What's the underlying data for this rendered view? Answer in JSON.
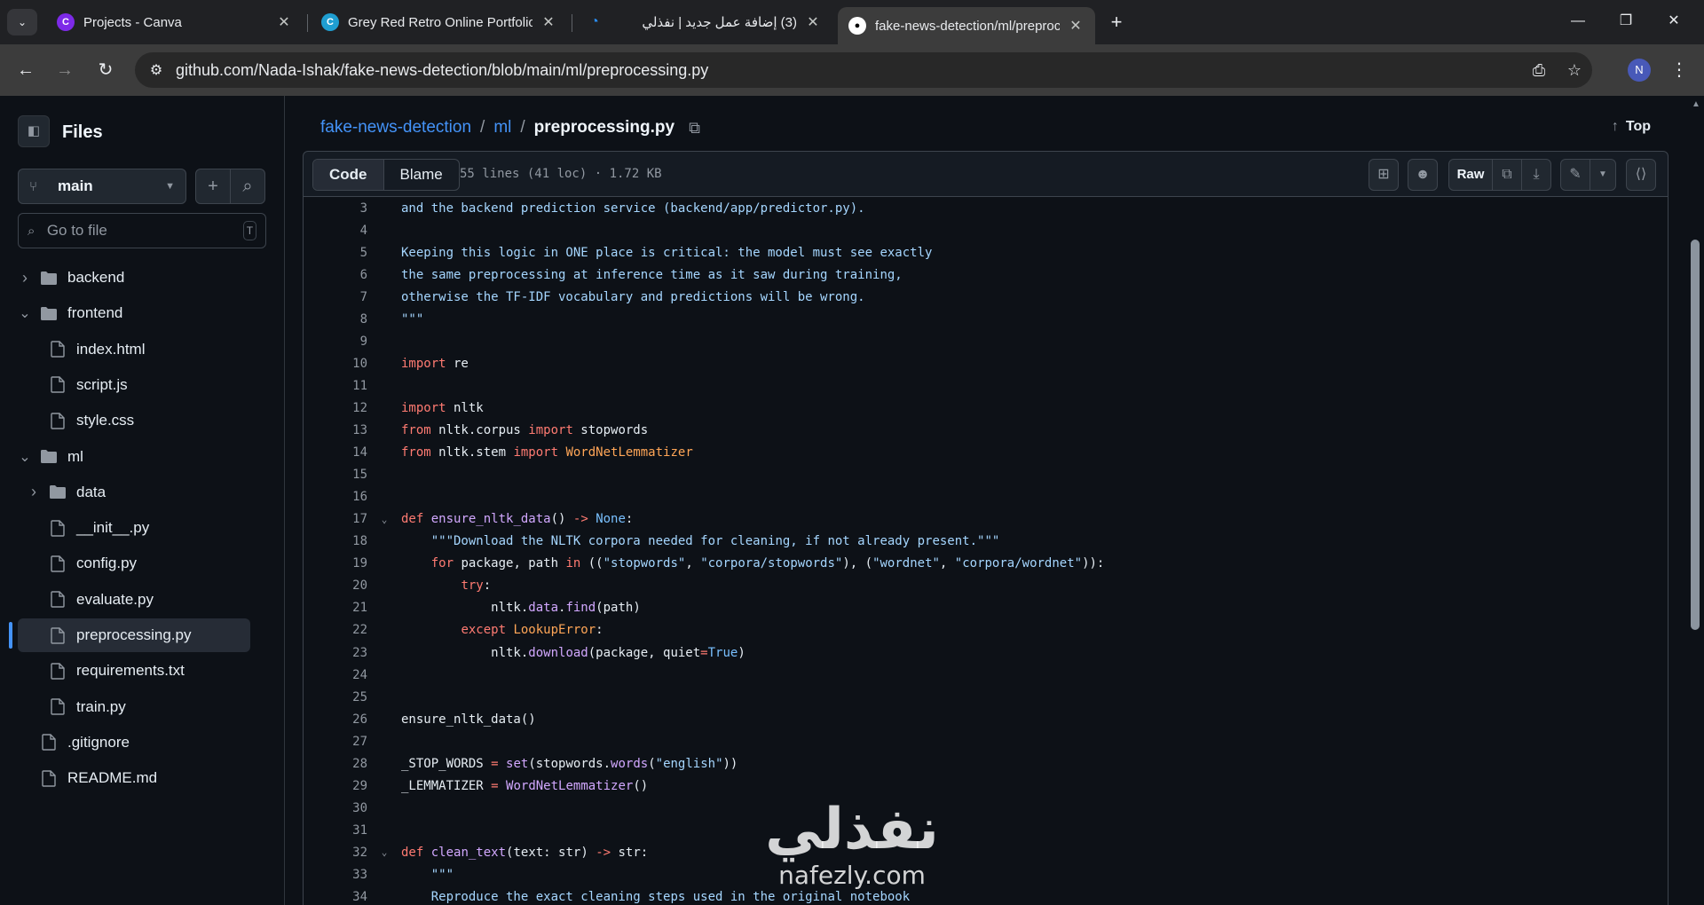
{
  "browser": {
    "tabs": [
      {
        "title": "Projects - Canva",
        "favicon": "canva-icon",
        "active": false
      },
      {
        "title": "Grey Red Retro Online Portfolio",
        "favicon": "canva-icon",
        "active": false
      },
      {
        "title": "(3) إضافة عمل جديد | نفذلي",
        "favicon": "nafezly-icon",
        "active": false
      },
      {
        "title": "fake-news-detection/ml/preproc",
        "favicon": "github-icon",
        "active": true
      }
    ],
    "url": "github.com/Nada-Ishak/fake-news-detection/blob/main/ml/preprocessing.py",
    "profile_initial": "N"
  },
  "sidebar": {
    "title": "Files",
    "branch": "main",
    "search_placeholder": "Go to file",
    "search_shortcut": "T",
    "tree": [
      {
        "label": "backend",
        "type": "folder",
        "depth": 0,
        "expanded": false
      },
      {
        "label": "frontend",
        "type": "folder",
        "depth": 0,
        "expanded": true
      },
      {
        "label": "index.html",
        "type": "file",
        "depth": 1
      },
      {
        "label": "script.js",
        "type": "file",
        "depth": 1
      },
      {
        "label": "style.css",
        "type": "file",
        "depth": 1
      },
      {
        "label": "ml",
        "type": "folder",
        "depth": 0,
        "expanded": true
      },
      {
        "label": "data",
        "type": "folder",
        "depth": 1,
        "expanded": false
      },
      {
        "label": "__init__.py",
        "type": "file",
        "depth": 1
      },
      {
        "label": "config.py",
        "type": "file",
        "depth": 1
      },
      {
        "label": "evaluate.py",
        "type": "file",
        "depth": 1
      },
      {
        "label": "preprocessing.py",
        "type": "file",
        "depth": 1,
        "selected": true
      },
      {
        "label": "requirements.txt",
        "type": "file",
        "depth": 1
      },
      {
        "label": "train.py",
        "type": "file",
        "depth": 1
      },
      {
        "label": ".gitignore",
        "type": "file",
        "depth": 0
      },
      {
        "label": "README.md",
        "type": "file",
        "depth": 0
      }
    ]
  },
  "breadcrumb": {
    "repo": "fake-news-detection",
    "dir": "ml",
    "file": "preprocessing.py",
    "sep": "/"
  },
  "top_label": "Top",
  "file_header": {
    "tab_code": "Code",
    "tab_blame": "Blame",
    "meta": "55 lines (41 loc) · 1.72 KB",
    "raw_label": "Raw"
  },
  "code_lines": [
    {
      "n": "3",
      "fold": false,
      "tokens": [
        [
          "s",
          "and the backend prediction service (backend/app/predictor.py).\n"
        ]
      ]
    },
    {
      "n": "4",
      "fold": false,
      "tokens": []
    },
    {
      "n": "5",
      "fold": false,
      "tokens": [
        [
          "s",
          "Keeping this logic in ONE place is critical: the model must see exactly"
        ]
      ]
    },
    {
      "n": "6",
      "fold": false,
      "tokens": [
        [
          "s",
          "the same preprocessing at inference time as it saw during training,"
        ]
      ]
    },
    {
      "n": "7",
      "fold": false,
      "tokens": [
        [
          "s",
          "otherwise the TF-IDF vocabulary and predictions will be wrong."
        ]
      ]
    },
    {
      "n": "8",
      "fold": false,
      "tokens": [
        [
          "s",
          "\"\"\""
        ]
      ]
    },
    {
      "n": "9",
      "fold": false,
      "tokens": []
    },
    {
      "n": "10",
      "fold": false,
      "tokens": [
        [
          "k",
          "import"
        ],
        [
          "src",
          " re"
        ]
      ]
    },
    {
      "n": "11",
      "fold": false,
      "tokens": []
    },
    {
      "n": "12",
      "fold": false,
      "tokens": [
        [
          "k",
          "import"
        ],
        [
          "src",
          " nltk"
        ]
      ]
    },
    {
      "n": "13",
      "fold": false,
      "tokens": [
        [
          "k",
          "from"
        ],
        [
          "src",
          " nltk.corpus "
        ],
        [
          "k",
          "import"
        ],
        [
          "src",
          " stopwords"
        ]
      ]
    },
    {
      "n": "14",
      "fold": false,
      "tokens": [
        [
          "k",
          "from"
        ],
        [
          "src",
          " nltk.stem "
        ],
        [
          "k",
          "import"
        ],
        [
          "src",
          " "
        ],
        [
          "cl",
          "WordNetLemmatizer"
        ]
      ]
    },
    {
      "n": "15",
      "fold": false,
      "tokens": []
    },
    {
      "n": "16",
      "fold": false,
      "tokens": []
    },
    {
      "n": "17",
      "fold": true,
      "tokens": [
        [
          "k",
          "def"
        ],
        [
          "src",
          " "
        ],
        [
          "f",
          "ensure_nltk_data"
        ],
        [
          "src",
          "() "
        ],
        [
          "k",
          "->"
        ],
        [
          "src",
          " "
        ],
        [
          "c",
          "None"
        ],
        [
          "src",
          ":"
        ]
      ]
    },
    {
      "n": "18",
      "fold": false,
      "tokens": [
        [
          "src",
          "    "
        ],
        [
          "s",
          "\"\"\"Download the NLTK corpora needed for cleaning, if not already present.\"\"\""
        ]
      ]
    },
    {
      "n": "19",
      "fold": false,
      "tokens": [
        [
          "src",
          "    "
        ],
        [
          "k",
          "for"
        ],
        [
          "src",
          " package, path "
        ],
        [
          "k",
          "in"
        ],
        [
          "src",
          " (("
        ],
        [
          "s",
          "\"stopwords\""
        ],
        [
          "src",
          ", "
        ],
        [
          "s",
          "\"corpora/stopwords\""
        ],
        [
          "src",
          "), ("
        ],
        [
          "s",
          "\"wordnet\""
        ],
        [
          "src",
          ", "
        ],
        [
          "s",
          "\"corpora/wordnet\""
        ],
        [
          "src",
          ")):"
        ]
      ]
    },
    {
      "n": "20",
      "fold": false,
      "tokens": [
        [
          "src",
          "        "
        ],
        [
          "k",
          "try"
        ],
        [
          "src",
          ":"
        ]
      ]
    },
    {
      "n": "21",
      "fold": false,
      "tokens": [
        [
          "src",
          "            nltk."
        ],
        [
          "f",
          "data"
        ],
        [
          "src",
          "."
        ],
        [
          "f",
          "find"
        ],
        [
          "src",
          "(path)"
        ]
      ]
    },
    {
      "n": "22",
      "fold": false,
      "tokens": [
        [
          "src",
          "        "
        ],
        [
          "k",
          "except"
        ],
        [
          "src",
          " "
        ],
        [
          "cl",
          "LookupError"
        ],
        [
          "src",
          ":"
        ]
      ]
    },
    {
      "n": "23",
      "fold": false,
      "tokens": [
        [
          "src",
          "            nltk."
        ],
        [
          "f",
          "download"
        ],
        [
          "src",
          "(package, quiet"
        ],
        [
          "k",
          "="
        ],
        [
          "c",
          "True"
        ],
        [
          "src",
          ")"
        ]
      ]
    },
    {
      "n": "24",
      "fold": false,
      "tokens": []
    },
    {
      "n": "25",
      "fold": false,
      "tokens": []
    },
    {
      "n": "26",
      "fold": false,
      "tokens": [
        [
          "src",
          "ensure_nltk_data()"
        ]
      ]
    },
    {
      "n": "27",
      "fold": false,
      "tokens": []
    },
    {
      "n": "28",
      "fold": false,
      "tokens": [
        [
          "src",
          "_STOP_WORDS "
        ],
        [
          "k",
          "="
        ],
        [
          "src",
          " "
        ],
        [
          "f",
          "set"
        ],
        [
          "src",
          "(stopwords."
        ],
        [
          "f",
          "words"
        ],
        [
          "src",
          "("
        ],
        [
          "s",
          "\"english\""
        ],
        [
          "src",
          "))"
        ]
      ]
    },
    {
      "n": "29",
      "fold": false,
      "tokens": [
        [
          "src",
          "_LEMMATIZER "
        ],
        [
          "k",
          "="
        ],
        [
          "src",
          " "
        ],
        [
          "f",
          "WordNetLemmatizer"
        ],
        [
          "src",
          "()"
        ]
      ]
    },
    {
      "n": "30",
      "fold": false,
      "tokens": []
    },
    {
      "n": "31",
      "fold": false,
      "tokens": []
    },
    {
      "n": "32",
      "fold": true,
      "tokens": [
        [
          "k",
          "def"
        ],
        [
          "src",
          " "
        ],
        [
          "f",
          "clean_text"
        ],
        [
          "src",
          "(text: str) "
        ],
        [
          "k",
          "->"
        ],
        [
          "src",
          " str:"
        ]
      ]
    },
    {
      "n": "33",
      "fold": false,
      "tokens": [
        [
          "src",
          "    "
        ],
        [
          "s",
          "\"\"\""
        ]
      ]
    },
    {
      "n": "34",
      "fold": false,
      "tokens": [
        [
          "src",
          "    "
        ],
        [
          "s",
          "Reproduce the exact cleaning steps used in the original notebook"
        ]
      ]
    }
  ],
  "watermark": {
    "arabic": "نفذلي",
    "latin": "nafezly.com"
  },
  "colors": {
    "link": "#4493f8",
    "keyword": "#ff7b72",
    "string": "#a5d6ff",
    "function": "#d2a8ff",
    "constant": "#79c0ff",
    "class": "#ffa657"
  }
}
